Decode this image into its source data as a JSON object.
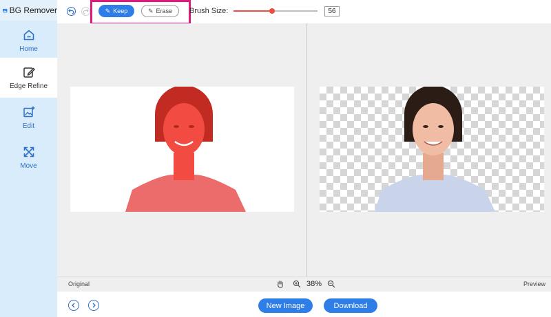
{
  "app": {
    "title": "BG Remover"
  },
  "sidebar": {
    "items": [
      {
        "label": "Home"
      },
      {
        "label": "Edge Refine"
      },
      {
        "label": "Edit"
      },
      {
        "label": "Move"
      }
    ],
    "active": "Edge Refine"
  },
  "toolbar": {
    "keep_label": "Keep",
    "erase_label": "Erase",
    "brush_label": "Brush Size:",
    "brush_value": "56",
    "brush_level": 0.46
  },
  "panes": {
    "original_label": "Original",
    "preview_label": "Preview"
  },
  "zoom": {
    "value": "38%"
  },
  "actions": {
    "new_image_label": "New Image",
    "download_label": "Download"
  },
  "colors": {
    "accent": "#2f7ee8",
    "highlight": "#e0197c",
    "mask": "#f04a40"
  }
}
